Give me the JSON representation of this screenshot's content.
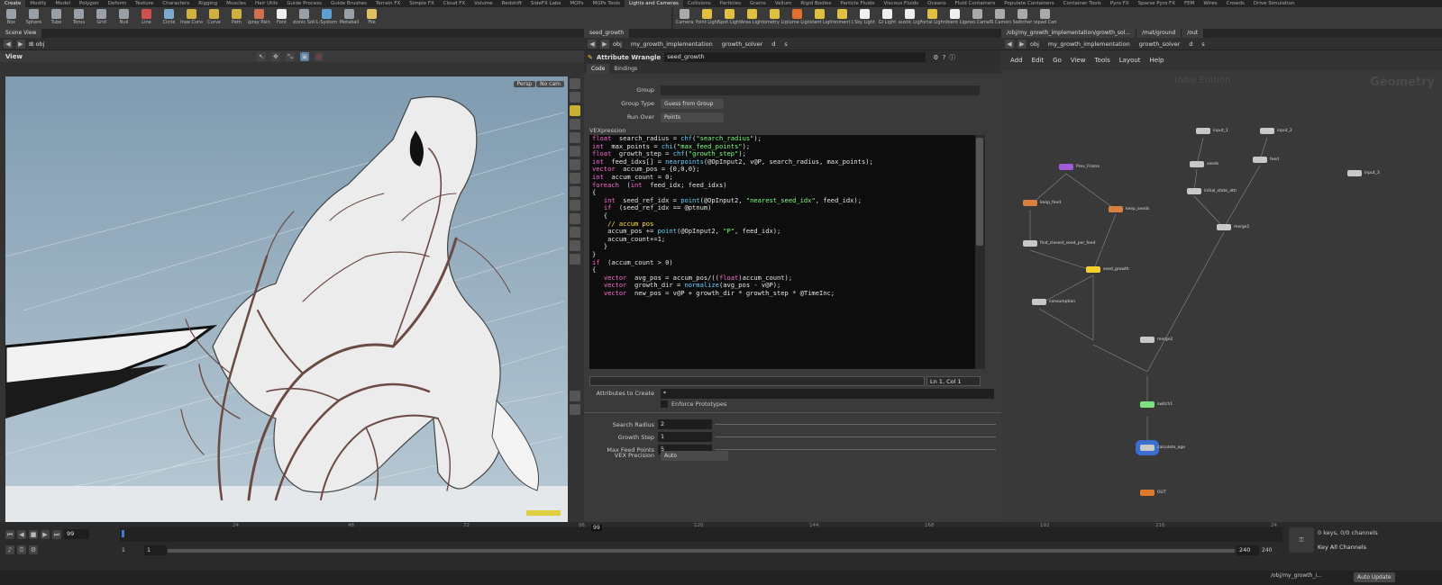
{
  "shelf_tabs": [
    "Create",
    "Modify",
    "Model",
    "Polygon",
    "Deform",
    "Texture",
    "Characters",
    "Rigging",
    "Muscles",
    "Hair Utils",
    "Guide Process",
    "Guide Brushes",
    "Terrain FX",
    "Simple FX",
    "Cloud FX",
    "Volume",
    "Redshift",
    "SideFX Labs",
    "MOPs",
    "MOPs Tools",
    "Lights and Cameras",
    "Collisions",
    "Particles",
    "Grains",
    "Vellum",
    "Rigid Bodies",
    "Particle Fluids",
    "Viscous Fluids",
    "Oceans",
    "Fluid Containers",
    "Populate Containers",
    "Container Tools",
    "Pyro FX",
    "Sparse Pyro FX",
    "FEM",
    "Wires",
    "Crowds",
    "Drive Simulation"
  ],
  "tools_left": [
    {
      "label": "Box",
      "color": "#9aa0a8"
    },
    {
      "label": "Sphere",
      "color": "#9aa0a8"
    },
    {
      "label": "Tube",
      "color": "#9aa0a8"
    },
    {
      "label": "Torus",
      "color": "#9aa0a8"
    },
    {
      "label": "Grid",
      "color": "#9aa0a8"
    },
    {
      "label": "Null",
      "color": "#9aa0a8"
    },
    {
      "label": "Line",
      "color": "#d05050"
    },
    {
      "label": "Circle",
      "color": "#7fa8d0"
    },
    {
      "label": "Draw Curve",
      "color": "#d0b040"
    },
    {
      "label": "Curve",
      "color": "#d0b040"
    },
    {
      "label": "Path",
      "color": "#d0b040"
    },
    {
      "label": "Spray Paint",
      "color": "#d07050"
    },
    {
      "label": "Font",
      "color": "#eeeeee"
    },
    {
      "label": "Platonic Solids",
      "color": "#9aa0a8"
    },
    {
      "label": "L-System",
      "color": "#60a0d0"
    },
    {
      "label": "Metaball",
      "color": "#9aa0a8"
    },
    {
      "label": "File",
      "color": "#e0c060"
    }
  ],
  "tools_right": [
    {
      "label": "Camera",
      "color": "#aaaaaa"
    },
    {
      "label": "Point Light",
      "color": "#e0c040"
    },
    {
      "label": "Spot Light",
      "color": "#e0c040"
    },
    {
      "label": "Area Light",
      "color": "#e0c040"
    },
    {
      "label": "Geometry Light",
      "color": "#e0c040"
    },
    {
      "label": "Volume Light",
      "color": "#e07030"
    },
    {
      "label": "Distant Light",
      "color": "#e0c040"
    },
    {
      "label": "Environment Light",
      "color": "#e0c040"
    },
    {
      "label": "Sky Light",
      "color": "#eeeeee"
    },
    {
      "label": "GI Light",
      "color": "#eeeeee"
    },
    {
      "label": "Caustic Light",
      "color": "#eeeeee"
    },
    {
      "label": "Portal Light",
      "color": "#e0c040"
    },
    {
      "label": "Ambient Light",
      "color": "#eeeeee"
    },
    {
      "label": "Stereo Camera",
      "color": "#aaaaaa"
    },
    {
      "label": "VR Camera",
      "color": "#aaaaaa"
    },
    {
      "label": "Switcher",
      "color": "#aaaaaa"
    },
    {
      "label": "Gamepad Camera",
      "color": "#aaaaaa"
    }
  ],
  "left": {
    "tab": "Scene View",
    "path": "obj",
    "view_label": "View",
    "persp": "Persp",
    "cam": "No cam"
  },
  "mid": {
    "tab": "seed_growth",
    "path": [
      "obj",
      "my_growth_implementation",
      "growth_solver",
      "d",
      "s"
    ],
    "node_type": "Attribute Wrangle",
    "node_name": "seed_growth",
    "tabs": [
      "Code",
      "Bindings"
    ],
    "group_label": "Group",
    "group_value": "",
    "group_type_label": "Group Type",
    "group_type_value": "Guess from Group",
    "run_over_label": "Run Over",
    "run_over_value": "Points",
    "vex_label": "VEXpression",
    "status": "Ln 1, Col 1",
    "attr_label": "Attributes to Create",
    "attr_value": "*",
    "enforce_label": "Enforce Prototypes",
    "params": [
      {
        "label": "Search Radius",
        "value": "2"
      },
      {
        "label": "Growth Step",
        "value": "1"
      },
      {
        "label": "Max Feed Points",
        "value": "5"
      }
    ],
    "precision_label": "VEX Precision",
    "precision_value": "Auto"
  },
  "right": {
    "tabs": [
      "/obj/my_growth_implementation/growth_sol...",
      "/mat/ground",
      "/out"
    ],
    "path": [
      "obj",
      "my_growth_implementation",
      "growth_solver",
      "d",
      "s"
    ],
    "menu": [
      "Add",
      "Edit",
      "Go",
      "View",
      "Tools",
      "Layout",
      "Help"
    ],
    "watermark": "Indie Edition",
    "context": "Geometry"
  },
  "nodes": [
    {
      "name": "input_1",
      "color": "#c8c8c8"
    },
    {
      "name": "input_2",
      "color": "#c8c8c8"
    },
    {
      "name": "Prev_Frame",
      "color": "#a05cd6"
    },
    {
      "name": "seeds",
      "color": "#c8c8c8"
    },
    {
      "name": "feed",
      "color": "#c8c8c8"
    },
    {
      "name": "keep_feed",
      "color": "#d88040"
    },
    {
      "name": "keep_seeds",
      "color": "#d88040"
    },
    {
      "name": "initial_state_attr",
      "color": "#c8c8c8"
    },
    {
      "name": "merge1",
      "color": "#c8c8c8"
    },
    {
      "name": "find_closest_seed_per_feed",
      "color": "#c8c8c8"
    },
    {
      "name": "seed_growth",
      "color": "#f5d130"
    },
    {
      "name": "consumption",
      "color": "#c8c8c8"
    },
    {
      "name": "merge2",
      "color": "#c8c8c8"
    },
    {
      "name": "switch1",
      "color": "#7ee07e"
    },
    {
      "name": "calculate_age",
      "color": "#c8c8c8"
    },
    {
      "name": "OUT",
      "color": "#e07a2a"
    },
    {
      "name": "input_3",
      "color": "#c8c8c8"
    }
  ],
  "code_lines": [
    [
      [
        "kw",
        "float"
      ],
      [
        "",
        "  search_radius = "
      ],
      [
        "fn",
        "chf"
      ],
      [
        "",
        "("
      ],
      [
        "st",
        "\"search_radius\""
      ],
      [
        "",
        ");"
      ]
    ],
    [
      [
        "kw",
        "int"
      ],
      [
        "",
        "  max_points = "
      ],
      [
        "fn",
        "chi"
      ],
      [
        "",
        "("
      ],
      [
        "st",
        "\"max_feed_points\""
      ],
      [
        "",
        ");"
      ]
    ],
    [
      [
        "",
        ""
      ]
    ],
    [
      [
        "kw",
        "float"
      ],
      [
        "",
        "  growth_step = "
      ],
      [
        "fn",
        "chf"
      ],
      [
        "",
        "("
      ],
      [
        "st",
        "\"growth_step\""
      ],
      [
        "",
        ");"
      ]
    ],
    [
      [
        "",
        ""
      ]
    ],
    [
      [
        "",
        ""
      ]
    ],
    [
      [
        "",
        ""
      ]
    ],
    [
      [
        "kw",
        "int"
      ],
      [
        "",
        "  feed_idxs[] = "
      ],
      [
        "fn",
        "nearpoints"
      ],
      [
        "",
        "(@OpInput2, v@P, search_radius, max_points);"
      ]
    ],
    [
      [
        "",
        ""
      ]
    ],
    [
      [
        "kw",
        "vector"
      ],
      [
        "",
        "  accum_pos = {0,0,0};"
      ]
    ],
    [
      [
        "kw",
        "int"
      ],
      [
        "",
        "  accum_count = 0;"
      ]
    ],
    [
      [
        "",
        ""
      ]
    ],
    [
      [
        "kw",
        "foreach"
      ],
      [
        "",
        "  ("
      ],
      [
        "kw",
        "int"
      ],
      [
        "",
        "  feed_idx; feed_idxs)"
      ]
    ],
    [
      [
        "",
        "{"
      ]
    ],
    [
      [
        "",
        "   "
      ],
      [
        "kw",
        "int"
      ],
      [
        "",
        "  seed_ref_idx = "
      ],
      [
        "fn",
        "point"
      ],
      [
        "",
        "(@OpInput2, "
      ],
      [
        "st",
        "\"nearest_seed_idx\""
      ],
      [
        "",
        ", feed_idx);"
      ]
    ],
    [
      [
        "",
        "   "
      ],
      [
        "kw",
        "if"
      ],
      [
        "",
        "  (seed_ref_idx == @ptnum)"
      ]
    ],
    [
      [
        "",
        "   {"
      ]
    ],
    [
      [
        "",
        "    "
      ],
      [
        "cm",
        "// accum pos"
      ]
    ],
    [
      [
        "",
        "    accum_pos += "
      ],
      [
        "fn",
        "point"
      ],
      [
        "",
        "(@OpInput2, "
      ],
      [
        "st",
        "\"P\""
      ],
      [
        "",
        ", feed_idx);"
      ]
    ],
    [
      [
        "",
        "    accum_count+=1;"
      ]
    ],
    [
      [
        "",
        "   }"
      ]
    ],
    [
      [
        "",
        "}"
      ]
    ],
    [
      [
        "",
        ""
      ]
    ],
    [
      [
        "kw",
        "if"
      ],
      [
        "",
        "  (accum_count > 0)"
      ]
    ],
    [
      [
        "",
        "{"
      ]
    ],
    [
      [
        "",
        "   "
      ],
      [
        "kw",
        "vector"
      ],
      [
        "",
        "  avg_pos = accum_pos/(("
      ],
      [
        "kw",
        "float"
      ],
      [
        "",
        ")accum_count);"
      ]
    ],
    [
      [
        "",
        ""
      ]
    ],
    [
      [
        "",
        "   "
      ],
      [
        "kw",
        "vector"
      ],
      [
        "",
        "  growth_dir = "
      ],
      [
        "fn",
        "normalize"
      ],
      [
        "",
        "(avg_pos - v@P);"
      ]
    ],
    [
      [
        "",
        ""
      ]
    ],
    [
      [
        "",
        "   "
      ],
      [
        "kw",
        "vector"
      ],
      [
        "",
        "  new_pos = v@P + growth_dir * growth_step * @TimeInc;"
      ]
    ]
  ],
  "timeline": {
    "frame": "99",
    "ticks": [
      "24",
      "48",
      "72",
      "96",
      "120",
      "144",
      "168",
      "192",
      "216",
      "24"
    ],
    "start": "1",
    "start2": "1",
    "end": "240",
    "end2": "240",
    "keys": "0 keys, 0/0 channels",
    "key_all": "Key All Channels",
    "auto": "Auto Update",
    "status_path": "/obj/my_growth_i..."
  }
}
